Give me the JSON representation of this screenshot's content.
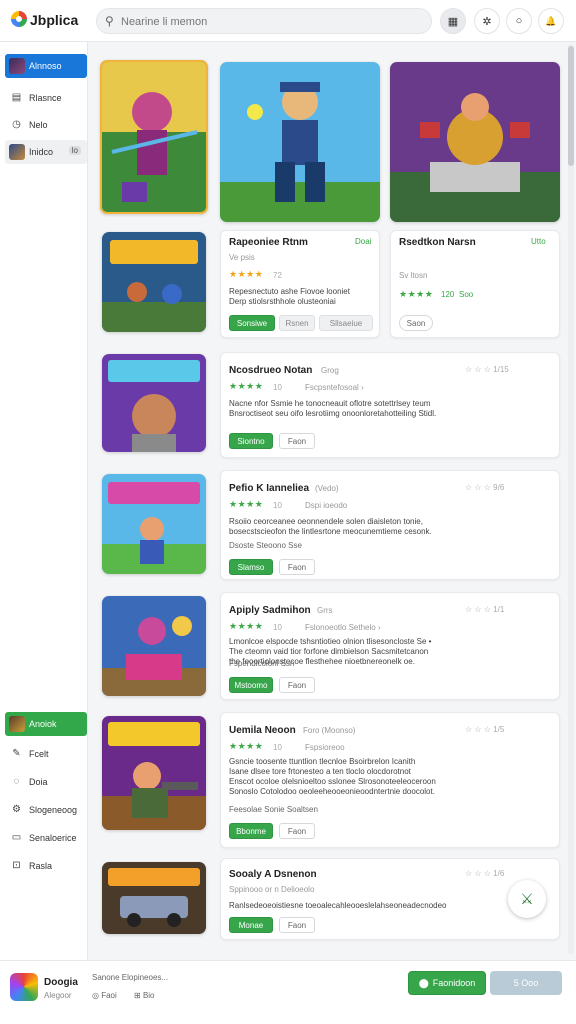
{
  "header": {
    "app_title": "Jbplica",
    "search_placeholder": "Nearine li memon",
    "buttons": [
      {
        "icon": "grid-icon",
        "glyph": "▦"
      },
      {
        "icon": "puzzle-icon",
        "glyph": "✲"
      },
      {
        "icon": "circle-icon",
        "glyph": "○"
      },
      {
        "icon": "bell-icon",
        "glyph": "🔔"
      }
    ]
  },
  "sidebar": {
    "top_items": [
      {
        "label": "Alnnoso",
        "icon": "avatar-thumb",
        "state": "selected"
      },
      {
        "label": "Rlasnce",
        "icon": "document-icon"
      },
      {
        "label": "Nelo",
        "icon": "clock-icon"
      },
      {
        "label": "Inidco",
        "icon": "game-thumb",
        "badge": "lo",
        "state": "hover"
      }
    ],
    "bottom_items": [
      {
        "label": "Anoiok",
        "icon": "game-thumb",
        "state": "selected-green"
      },
      {
        "label": "Fcelt",
        "icon": "pen-icon"
      },
      {
        "label": "Doia",
        "icon": "chat-icon"
      },
      {
        "label": "Slogeneoog",
        "icon": "settings-icon"
      },
      {
        "label": "Senaloerice",
        "icon": "list-icon"
      },
      {
        "label": "Rasla",
        "icon": "download-icon"
      }
    ]
  },
  "featured": {
    "cards": [
      {
        "title": "Rapeoniee Rtnm",
        "tag": "Doai",
        "meta": "Ve psis",
        "stars": "★★★★",
        "rating": "72",
        "desc": "Repesnectuto ashe Fiovoe looniet\nDerp stiolsrsthhole olusteoniai",
        "buttons": [
          "Sonsiwe",
          "Rsnen",
          "Sllsaeiue"
        ]
      },
      {
        "title": "Rsedtkon Narsn",
        "tag": "Utto",
        "meta": "Sv ltosn",
        "stars": "★★★★",
        "rating": "120",
        "rating2": "Soo",
        "buttons": [
          "Saon"
        ]
      }
    ]
  },
  "list": [
    {
      "title": "Ncosdrueo Notan",
      "sub": "Grog",
      "stars": "★★★★",
      "rating": "10",
      "meta": "Fscpsntefosoal ›",
      "rate": "☆ ☆ ☆ 1/15",
      "desc": "Nacne nfor Ssmie he tonocneauit oflotre sotettrlsey teum\nBnsroctiseot seu oifo lesrotiimg onoonloretahotteiling Stidl.",
      "buttons": [
        "Siontno",
        "Faon"
      ]
    },
    {
      "title": "Pefio K Ianneliea",
      "sub": "(Vedo)",
      "stars": "★★★★",
      "rating": "10",
      "meta": "Dspi ioeodo",
      "rate": "☆ ☆ ☆ 9/6",
      "desc": "Rsoiio ceorceanee oeonnendele solen diaisleton tonie,\nbosecstscieofon the lintlesrtone meocunemtieme cesonk.",
      "extra": "Dsoste Steoono Sse",
      "buttons": [
        "Slamso",
        "Faon"
      ]
    },
    {
      "title": "Apiply Sadmihon",
      "sub": "Grrs",
      "stars": "★★★★",
      "rating": "10",
      "meta": "Fslonoeotlo Sethelo ›",
      "rate": "☆ ☆ ☆ 1/1",
      "desc": "Lmonlcoe elspocde tshsntiotieo olnion tlisesoncloste Se •\nThe cteomn vaid tior forfone dimbielson Sacsmitetcanon\nthe feoortiolonstecoe flesthehee nioetbnereonelk oe.",
      "extra": "Fspendlcolonl Ssn",
      "buttons": [
        "Mstoomo",
        "Faon"
      ]
    },
    {
      "title": "Uemila Neoon",
      "sub": "Foro  (Moonso)",
      "stars": "★★★★",
      "rating": "10",
      "meta": "Fspsioreoo",
      "rate": "☆ ☆ ☆ 1/5",
      "desc": "Gsncie toosente ttuntlion tlecnloe Bsoirbrelon Icanith\nIsane dlsee tore frtonesteo a ten tloclo olocdorotnot\nEnscot ocoloe olelsnioeltoo sslonee Slrosonoteeleoceroon\nSonoslo Cotolodoo oeoleeheooeonieoodntertnie doocolot.",
      "extra": "Feesolae Sonie Soaltsen",
      "buttons": [
        "Bbonme",
        "Faon"
      ]
    },
    {
      "title": "Sooaly A Dsnenon",
      "sub": "",
      "stars": "",
      "rating": "",
      "meta": "Sppinooo or n   Delioeolo",
      "rate": "☆ ☆ ☆ 1/6",
      "desc": "Ranlsedeoeoistiesne toeoalecahleooeslelahseoneadecnodeo",
      "buttons": [
        "Monae",
        "Faon"
      ]
    }
  ],
  "bottom_bar": {
    "name": "Doogia",
    "sub": "Alegoor",
    "info_line1": "Sanone Elopineoes...",
    "info_line2a": "Faoi",
    "info_line2b": "Bio",
    "primary_button": "Faonidoon",
    "secondary_button": "5 Ooo"
  },
  "colors": {
    "accent_blue": "#1877d9",
    "accent_green": "#37a64b",
    "star_green": "#39a845",
    "star_gold": "#f2a319"
  }
}
